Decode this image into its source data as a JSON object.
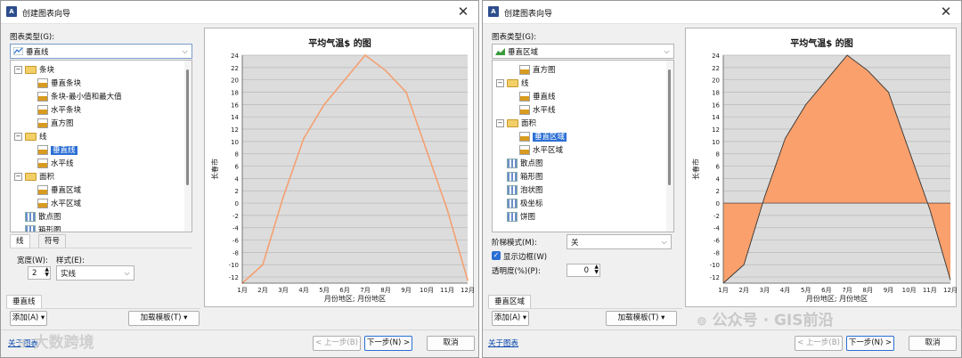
{
  "window1": {
    "title": "创建图表向导",
    "chart_type_label": "图表类型(G):",
    "chart_type_value": "垂直线",
    "tree": [
      {
        "label": "条块",
        "kind": "folder"
      },
      {
        "label": "垂直条块",
        "kind": "item"
      },
      {
        "label": "条块-最小值和最大值",
        "kind": "item"
      },
      {
        "label": "水平条块",
        "kind": "item"
      },
      {
        "label": "直方图",
        "kind": "item"
      },
      {
        "label": "线",
        "kind": "folder"
      },
      {
        "label": "垂直线",
        "kind": "item",
        "selected": true
      },
      {
        "label": "水平线",
        "kind": "item"
      },
      {
        "label": "面积",
        "kind": "folder"
      },
      {
        "label": "垂直区域",
        "kind": "item"
      },
      {
        "label": "水平区域",
        "kind": "item"
      },
      {
        "label": "散点图",
        "kind": "folder-item"
      },
      {
        "label": "箱形图",
        "kind": "folder-item"
      }
    ],
    "subtabs": [
      "线",
      "符号"
    ],
    "width_label": "宽度(W):",
    "width_value": "2",
    "style_label": "样式(E):",
    "style_value": "实线",
    "series_tab": "垂直线",
    "add_button": "添加(A)",
    "load_template_button": "加载模板(T)",
    "about_link": "关于图表",
    "back_button": "< 上一步(B)",
    "next_button": "下一步(N) >",
    "cancel_button": "取消"
  },
  "window2": {
    "title": "创建图表向导",
    "chart_type_label": "图表类型(G):",
    "chart_type_value": "垂直区域",
    "tree": [
      {
        "label": "直方图",
        "kind": "item"
      },
      {
        "label": "线",
        "kind": "folder"
      },
      {
        "label": "垂直线",
        "kind": "item"
      },
      {
        "label": "水平线",
        "kind": "item"
      },
      {
        "label": "面积",
        "kind": "folder"
      },
      {
        "label": "垂直区域",
        "kind": "item",
        "selected": true
      },
      {
        "label": "水平区域",
        "kind": "item"
      },
      {
        "label": "散点图",
        "kind": "folder-item"
      },
      {
        "label": "箱形图",
        "kind": "folder-item"
      },
      {
        "label": "泡状图",
        "kind": "folder-item"
      },
      {
        "label": "极坐标",
        "kind": "folder-item"
      },
      {
        "label": "饼图",
        "kind": "folder-item"
      }
    ],
    "step_mode_label": "阶梯模式(M):",
    "step_mode_value": "关",
    "show_border_label": "显示边框(W)",
    "transparency_label": "透明度(%)(P):",
    "transparency_value": "0",
    "series_tab": "垂直区域",
    "add_button": "添加(A)",
    "load_template_button": "加载模板(T)",
    "about_link": "关于图表",
    "back_button": "< 上一步(B)",
    "next_button": "下一步(N) >",
    "cancel_button": "取消"
  },
  "watermarks": {
    "left": "大数跨境",
    "right": "公众号 · GIS前沿"
  },
  "colors": {
    "line": "#f4a070",
    "area": "#f9a06c",
    "area_border": "#333333",
    "selection": "#2b6fd4"
  },
  "chart_data": [
    {
      "type": "line",
      "title": "平均气温$ 的图",
      "xlabel": "月份地区; 月份地区",
      "ylabel": "长春市",
      "categories": [
        "1月",
        "2月",
        "3月",
        "4月",
        "5月",
        "6月",
        "7月",
        "8月",
        "9月",
        "10月",
        "11月",
        "12月"
      ],
      "values": [
        -13,
        -10,
        1,
        10.5,
        16,
        20,
        24,
        21.5,
        18,
        8.5,
        -1,
        -12.5
      ],
      "ylim": [
        -13,
        24
      ],
      "yticks": [
        24,
        22,
        20,
        18,
        16,
        14,
        12,
        10,
        8,
        6,
        4,
        2,
        0,
        -2,
        -4,
        -6,
        -8,
        -10,
        -12
      ],
      "grid": true
    },
    {
      "type": "area",
      "title": "平均气温$ 的图",
      "xlabel": "月份地区; 月份地区",
      "ylabel": "长春市",
      "categories": [
        "1月",
        "2月",
        "3月",
        "4月",
        "5月",
        "6月",
        "7月",
        "8月",
        "9月",
        "10月",
        "11月",
        "12月"
      ],
      "values": [
        -13,
        -10,
        1,
        10.5,
        16,
        20,
        24,
        21.5,
        18,
        8.5,
        -1,
        -12.5
      ],
      "ylim": [
        -13,
        24
      ],
      "yticks": [
        24,
        22,
        20,
        18,
        16,
        14,
        12,
        10,
        8,
        6,
        4,
        2,
        0,
        -2,
        -4,
        -6,
        -8,
        -10,
        -12
      ],
      "grid": true
    }
  ]
}
